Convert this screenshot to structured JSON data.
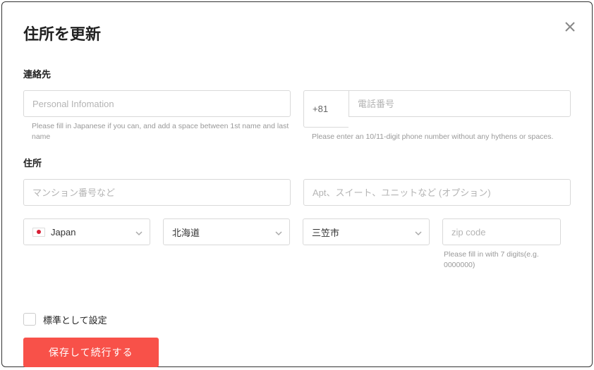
{
  "modal": {
    "title": "住所を更新"
  },
  "contact": {
    "section_label": "連絡先",
    "name_placeholder": "Personal Infomation",
    "name_helper": "Please fill in Japanese if you can, and add a space between 1st name and last name",
    "phone_prefix": "+81",
    "phone_placeholder": "電話番号",
    "phone_helper": "Please enter an 10/11-digit phone number without any hythens or spaces."
  },
  "address": {
    "section_label": "住所",
    "line1_placeholder": "マンション番号など",
    "line2_placeholder": "Apt、スイート、ユニットなど (オプション)",
    "country": "Japan",
    "prefecture": "北海道",
    "city": "三笠市",
    "zip_placeholder": "zip code",
    "zip_helper": "Please fill in with 7 digits(e.g. 0000000)"
  },
  "default": {
    "label": "標準として設定"
  },
  "actions": {
    "save": "保存して続行する"
  }
}
